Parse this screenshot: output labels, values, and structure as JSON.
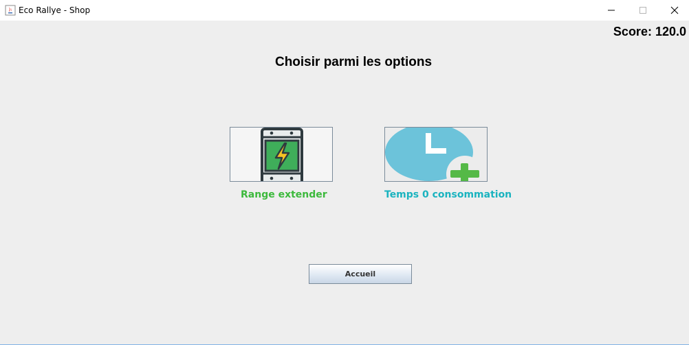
{
  "window": {
    "title": "Eco Rallye - Shop",
    "app_icon": "java-icon",
    "controls": [
      "minimize-icon",
      "maximize-icon",
      "close-icon"
    ]
  },
  "score": {
    "text": "Score: 120.0"
  },
  "heading": "Choisir parmi les options",
  "options": [
    {
      "label": "Range extender",
      "icon": "battery-charging-icon",
      "color": "#3cb93c"
    },
    {
      "label": "Temps 0 consommation",
      "icon": "clock-plus-icon",
      "color": "#1ab3bf"
    }
  ],
  "buttons": {
    "home_label": "Accueil"
  },
  "colors": {
    "background": "#eeeeee",
    "titlebar": "#ffffff",
    "accent_green": "#3cb93c",
    "accent_teal": "#1ab3bf"
  }
}
